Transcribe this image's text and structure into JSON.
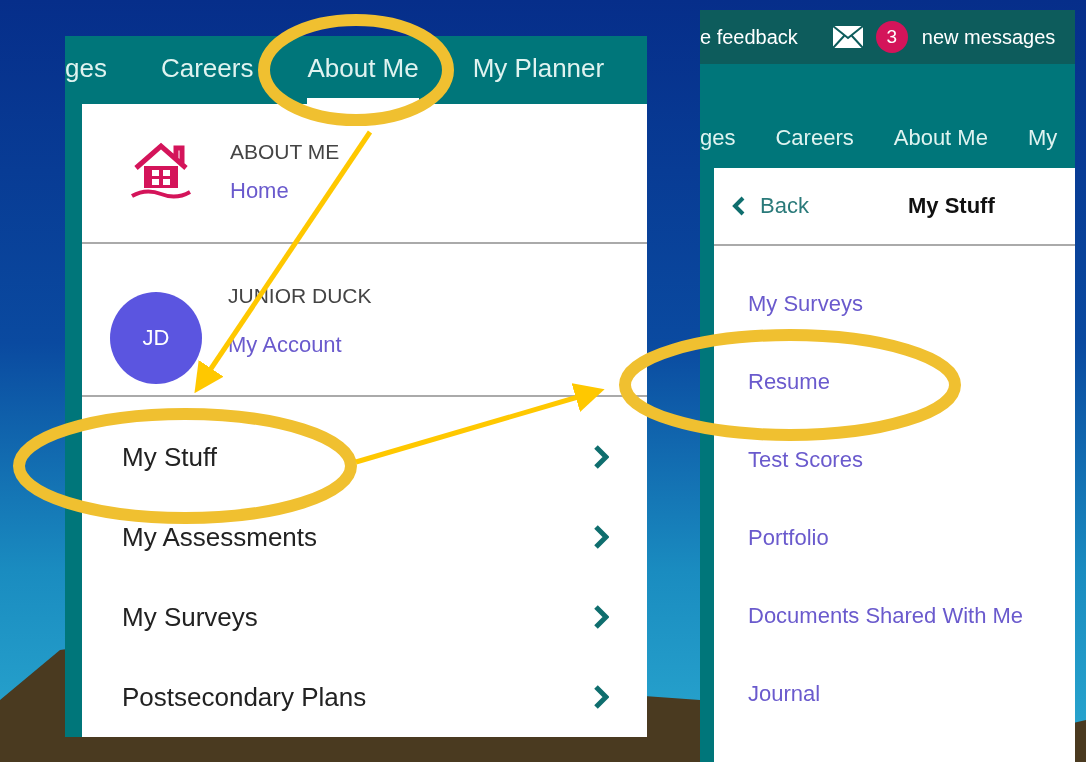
{
  "left_panel": {
    "tabs": [
      {
        "label": "ges",
        "selected": false
      },
      {
        "label": "Careers",
        "selected": false
      },
      {
        "label": "About Me",
        "selected": true
      },
      {
        "label": "My Planner",
        "selected": false
      }
    ],
    "section_header": {
      "title": "ABOUT ME",
      "link": "Home"
    },
    "account": {
      "initials": "JD",
      "name": "JUNIOR DUCK",
      "link": "My Account"
    },
    "menu_items": [
      {
        "label": "My Stuff"
      },
      {
        "label": "My Assessments"
      },
      {
        "label": "My Surveys"
      },
      {
        "label": "Postsecondary Plans"
      }
    ]
  },
  "right_panel": {
    "top_bar": {
      "feedback": "e feedback",
      "message_count": "3",
      "messages_label": "new messages"
    },
    "tabs": [
      {
        "label": "ges",
        "selected": false
      },
      {
        "label": "Careers",
        "selected": false
      },
      {
        "label": "About Me",
        "selected": false
      },
      {
        "label": "My",
        "selected": false
      }
    ],
    "back": "Back",
    "title": "My Stuff",
    "links": [
      {
        "label": "My Surveys"
      },
      {
        "label": "Resume"
      },
      {
        "label": "Test Scores"
      },
      {
        "label": "Portfolio"
      },
      {
        "label": "Documents Shared With Me"
      },
      {
        "label": "Journal"
      }
    ]
  }
}
